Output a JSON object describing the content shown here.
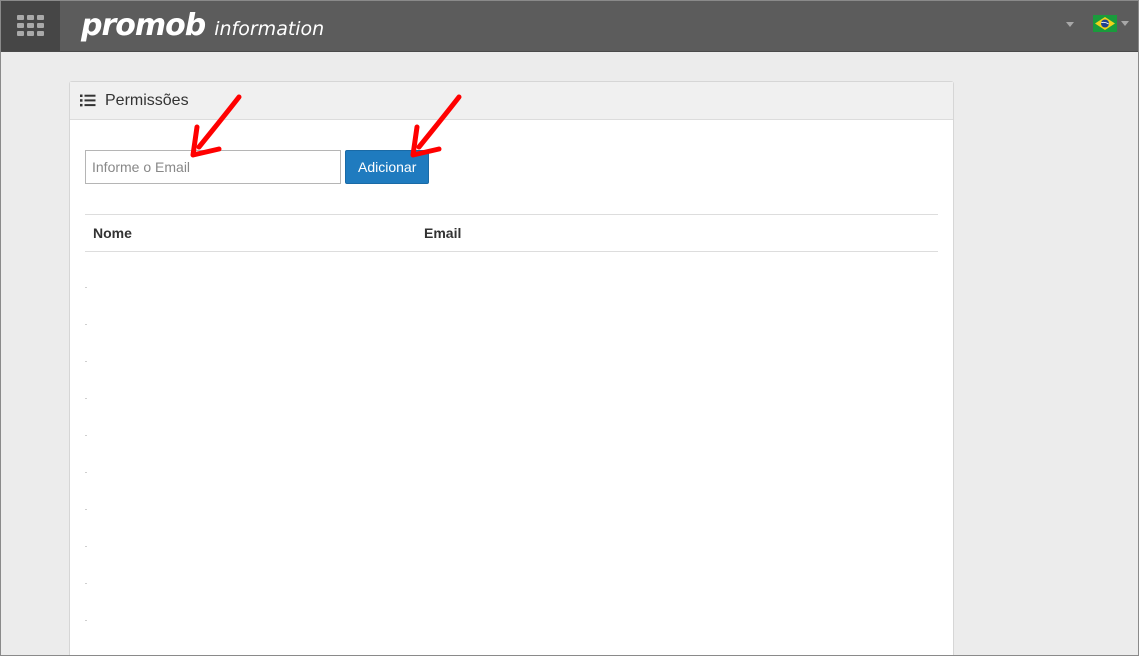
{
  "header": {
    "brand": "promob",
    "product": "information",
    "apps_icon": "grid-icon",
    "user_menu_icon": "caret-down-icon",
    "language_icon": "brazil-flag-icon"
  },
  "panel": {
    "title": "Permissões",
    "title_icon": "list-icon",
    "email_placeholder": "Informe o Email",
    "email_value": "",
    "add_label": "Adicionar",
    "table": {
      "columns": [
        "Nome",
        "Email"
      ],
      "rows": []
    }
  },
  "annotations": {
    "arrow_color": "#ff0000"
  },
  "colors": {
    "topbar": "#5c5c5c",
    "primary_button": "#1f7bbf",
    "background": "#ececec"
  }
}
